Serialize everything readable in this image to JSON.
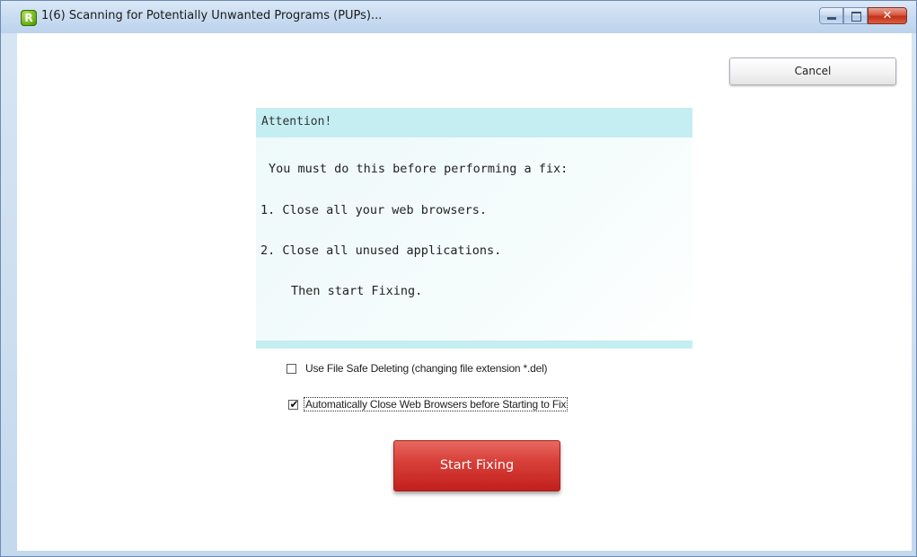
{
  "window": {
    "title": "1(6) Scanning for Potentially Unwanted Programs (PUPs)...",
    "app_icon_letter": "R",
    "minimize_icon": "minimize-icon",
    "maximize_icon": "maximize-icon",
    "close_glyph": "✕"
  },
  "toolbar": {
    "cancel_label": "Cancel"
  },
  "attention": {
    "title": "Attention!",
    "intro": "You must do this before performing a fix:",
    "step1": "1. Close all your web browsers.",
    "step2": "2. Close all unused applications.",
    "outro": "Then start Fixing."
  },
  "options": {
    "safe_delete": {
      "label": "Use File Safe Deleting (changing file extension *.del)",
      "checked": false
    },
    "auto_close": {
      "label": "Automatically Close Web Browsers before Starting to Fix",
      "checked": true,
      "check_glyph": "✔"
    }
  },
  "actions": {
    "start_fixing_label": "Start Fixing"
  },
  "colors": {
    "accent_panel": "#c4eef2",
    "start_button": "#d9403a",
    "close_button": "#c1301a"
  }
}
